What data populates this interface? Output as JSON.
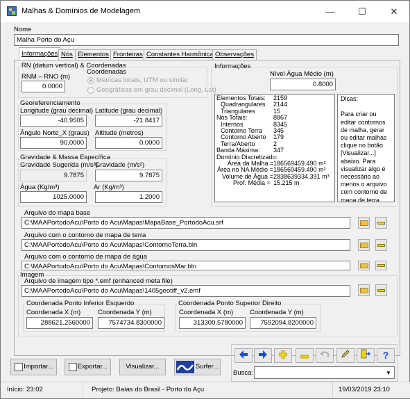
{
  "window": {
    "title": "Malhas & Domínios de Modelagem",
    "minimize": "—",
    "maximize": "☐",
    "close": "✕"
  },
  "nome": {
    "label": "Nome",
    "value": "Malha Porto do Açu"
  },
  "tabs": [
    "Informações",
    "Nós",
    "Elementos",
    "Fronteiras",
    "Constantes Harmônicas",
    "Observações"
  ],
  "rn": {
    "group": "RN (datum vertical) & Coordenadas",
    "label": "RNM – RNO (m)",
    "value": "0.0000",
    "coord_label": "Coordenadas",
    "opt1": "Métricas locais, UTM ou similar",
    "opt2": "Geográficas em grau decimal (Long, Lat)"
  },
  "geo": {
    "group": "Georeferenciamento",
    "lon_label": "Longitude (grau decimal)",
    "lon": "-40.9505",
    "lat_label": "Latitude (grau decimal)",
    "lat": "-21.8417",
    "ang_label": "Ângulo Norte_X (graus)",
    "ang": "90.0000",
    "alt_label": "Altitude (metros)",
    "alt": "0.0000"
  },
  "grav": {
    "group": "Gravidade & Massa Específica",
    "gs_label": "Gravidade Sugerida (m/s²)",
    "gs": "9.7875",
    "g_label": "Gravidade (m/s²)",
    "g": "9.7875",
    "agua_label": "Água (Kg/m³)",
    "agua": "1025.0000",
    "ar_label": "Ar (Kg/m³)",
    "ar": "1.2000"
  },
  "info": {
    "group": "Informações",
    "nivel_label": "Nível Água Médio (m)",
    "nivel": "0.8000"
  },
  "stats": [
    {
      "k": "Elementos Totais:",
      "v": "2159",
      "ki": 0
    },
    {
      "k": "Quadrangulares",
      "v": "2144",
      "ki": 1
    },
    {
      "k": "Triangulares",
      "v": "15",
      "ki": 1
    },
    {
      "k": "Nós Totais:",
      "v": "8867",
      "ki": 0
    },
    {
      "k": "Internos",
      "v": "8345",
      "ki": 1
    },
    {
      "k": "Contorno Terra",
      "v": "345",
      "ki": 1
    },
    {
      "k": "Contorno Aberto",
      "v": "179",
      "ki": 1
    },
    {
      "k": "Terra/Aberto",
      "v": "2",
      "ki": 1
    },
    {
      "k": "Banda Máxima:",
      "v": "347",
      "ki": 0
    },
    {
      "k": "Domínio Discretizado:",
      "v": "",
      "ki": 0
    },
    {
      "k": "Área da Malha =",
      "v": "186569459.490 m²",
      "ki": 2
    },
    {
      "k": "Área no NA Médio =",
      "v": "186569459.490 m²",
      "ki": 3
    },
    {
      "k": "Volume de Água =",
      "v": "2838639334.391 m³",
      "ki": 4
    },
    {
      "k": "Prof. Média =",
      "v": "15.215 m",
      "ki": 5
    }
  ],
  "dicas": "Dicas:\n\nPara criar ou editar contornos de malha, gerar ou editar malhas clique no botão [Visualizar...] abaixo. Para visualizar algo é necessário ao menos o arquivo com contorno de mapa de terra e/ou de mapa de água",
  "files": {
    "base_label": "Arquivo do mapa base",
    "base": "C:\\MAAPortodoAcu\\Porto do Acu\\Mapas\\MapaBase_PortodoAcu.srf",
    "terra_label": "Arquivo com o contorno de mapa de terra",
    "terra": "C:\\MAAPortodoAcu\\Porto do Acu\\Mapas\\ContornoTerra.bln",
    "agua_label": "Arquivo com o contorno de mapa de água",
    "agua": "C:\\MAAPortodoAcu\\Porto do Acu\\Mapas\\ContornosMar.bln"
  },
  "imagem": {
    "group": "Imagem",
    "file_label": "Arquivo de imagem tipo *.emf (enhanced meta file)",
    "file": "C:\\MAAPortodoAcu\\Porto do Acu\\Mapas\\1405geotiff_v2.emf",
    "inf_group": "Coordenada Ponto Inferior Esquerdo",
    "sup_group": "Coordenada Ponto Superior Direito",
    "x_label": "Coordenada X (m)",
    "y_label": "Coordenada Y (m)",
    "inf_x": "288621.2560000",
    "inf_y": "7574734.8300000",
    "sup_x": "313300.5780000",
    "sup_y": "7592094.8200000"
  },
  "buttons": {
    "importar": "Importar...",
    "exportar": "Exportar...",
    "visualizar": "Visualizar...",
    "surfer": "Surfer..."
  },
  "busca": {
    "label": "Busca:",
    "value": ""
  },
  "status": {
    "inicio": "Início: 23:02",
    "projeto": "Projeto: Baías do Brasil - Porto do Açu",
    "data": "19/03/2019 23:10"
  },
  "colors": {
    "nav_blue": "#1a4fd0",
    "nav_yellow": "#f2d600",
    "folder": "#e8c14a",
    "minus_bar": "#f2d600"
  }
}
